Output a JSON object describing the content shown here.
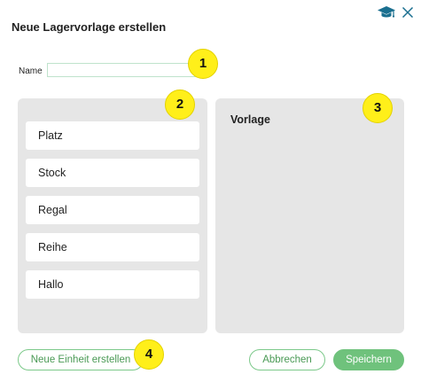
{
  "dialog": {
    "title": "Neue Lagervorlage erstellen"
  },
  "icons": {
    "help": "graduation-cap-icon",
    "close": "close-icon",
    "accent": "#1a6f8f"
  },
  "name_field": {
    "label": "Name",
    "value": "",
    "placeholder": ""
  },
  "units": [
    "Platz",
    "Stock",
    "Regal",
    "Reihe",
    "Hallo"
  ],
  "template_panel": {
    "title": "Vorlage"
  },
  "buttons": {
    "new_unit": "Neue Einheit erstellen",
    "cancel": "Abbrechen",
    "save": "Speichern"
  },
  "callouts": [
    "1",
    "2",
    "3",
    "4"
  ],
  "colors": {
    "accent_green": "#6fc27c",
    "panel_bg": "#e6e6e6",
    "callout_yellow": "#ffef1a"
  }
}
